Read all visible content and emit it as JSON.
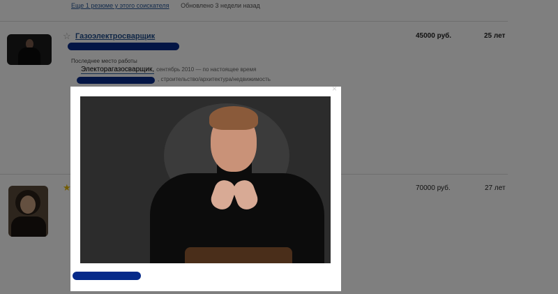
{
  "top_meta": {
    "resumes_link": "Еще 1 резюме у этого соискателя",
    "updated": "Обновлено 3 недели назад"
  },
  "results": [
    {
      "title": "Газоэлектросварщик",
      "salary": "45000 руб.",
      "age": "25 лет",
      "favorite": false,
      "last_work_label": "Последнее место работы",
      "last_position": "Электорагазосварщик,",
      "last_dates": "сентябрь 2010 — по настоящее время",
      "industry": ", строительство/архитектура/недвижимость"
    },
    {
      "salary": "70000 руб.",
      "age": "27 лет",
      "favorite": true
    }
  ],
  "modal": {
    "close_icon": "×",
    "photo_icon": "photo-portrait"
  },
  "icons": {
    "star_empty": "☆",
    "star_filled": "★"
  },
  "colors": {
    "link": "#1f4d8c",
    "redaction": "#062a8a",
    "overlay": "rgba(0,0,0,0.5)",
    "favorite_star": "#e6b800"
  }
}
